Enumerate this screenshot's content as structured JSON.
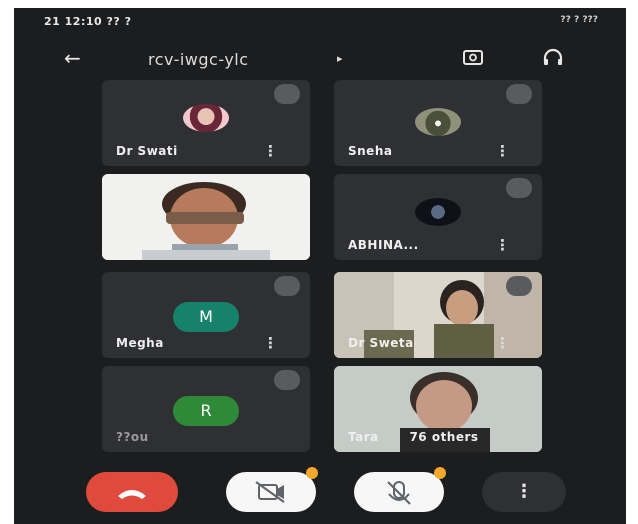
{
  "status_bar": {
    "left_text": "21 12:10 ?? ?",
    "right_text": "?? ? ???"
  },
  "header": {
    "meeting_code": "rcv-iwgc-ylc",
    "title_arrow": "▸"
  },
  "participants": [
    {
      "name": "Dr Swati",
      "kebab": "⋮",
      "type": "photo-small"
    },
    {
      "name": "Sneha",
      "kebab": "⋮",
      "type": "photo-small"
    },
    {
      "name": "",
      "kebab": "",
      "type": "video"
    },
    {
      "name": "ABHINA...",
      "kebab": "⋮",
      "type": "photo-small"
    },
    {
      "name": "Megha",
      "kebab": "⋮",
      "initial": "M",
      "initial_color": "#16826b",
      "type": "letter"
    },
    {
      "name": "Dr Sweta",
      "kebab": "⋮",
      "type": "video"
    },
    {
      "name": "??ou",
      "kebab": "",
      "initial": "R",
      "initial_color": "#2e8a37",
      "type": "letter"
    },
    {
      "name": "Tara",
      "extra": "76 others",
      "kebab": "",
      "type": "video"
    }
  ],
  "icons": {
    "back": "back-arrow-icon",
    "switch_camera": "switch-camera-icon",
    "audio": "headphones-icon",
    "mute": "mic-off-icon",
    "end_call": "end-call-icon",
    "camera": "camera-off-icon",
    "mic": "mic-off-icon",
    "more": "more-options-icon"
  },
  "controls": {
    "more_symbol": "⋮"
  },
  "colors": {
    "end_call": "#e04a3c",
    "badge": "#f2a82d"
  }
}
